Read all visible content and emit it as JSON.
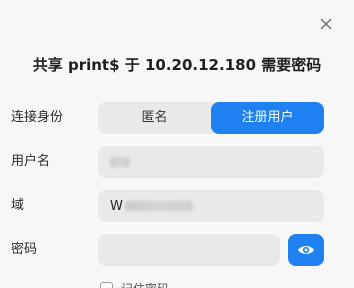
{
  "dialog": {
    "title": "共享 print$ 于 10.20.12.180 需要密码",
    "close_icon": "close-icon"
  },
  "identity": {
    "label": "连接身份",
    "options": [
      "匿名",
      "注册用户"
    ],
    "selected": "注册用户"
  },
  "username": {
    "label": "用户名",
    "value": ""
  },
  "domain": {
    "label": "域",
    "value": "W"
  },
  "password": {
    "label": "密码",
    "value": "",
    "toggle_icon": "eye-icon"
  },
  "remember": {
    "label": "记住密码",
    "checked": false
  },
  "colors": {
    "accent": "#1f81f1",
    "background": "#f7f7f7",
    "field": "#e9e9e9"
  }
}
